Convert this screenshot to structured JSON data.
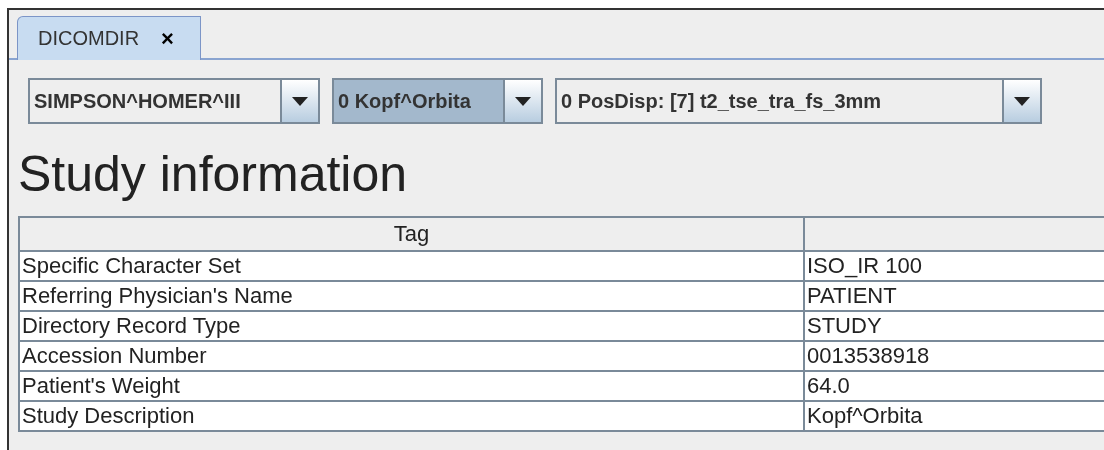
{
  "tabs": [
    {
      "label": "DICOMDIR",
      "close": "×",
      "selected": true
    }
  ],
  "combos": [
    {
      "value": "SIMPSON^HOMER^III",
      "focused": false
    },
    {
      "value": "0 Kopf^Orbita",
      "focused": true
    },
    {
      "value": "0 PosDisp: [7] t2_tse_tra_fs_3mm",
      "focused": false
    }
  ],
  "heading": "Study information",
  "table": {
    "columns": [
      "Tag"
    ],
    "rows": [
      {
        "tag": "Specific Character Set",
        "value": "ISO_IR 100"
      },
      {
        "tag": "Referring Physician's Name",
        "value": "PATIENT"
      },
      {
        "tag": "Directory Record Type",
        "value": "STUDY"
      },
      {
        "tag": "Accession Number",
        "value": "0013538918"
      },
      {
        "tag": "Patient's Weight",
        "value": "64.0"
      },
      {
        "tag": "Study Description",
        "value": "Kopf^Orbita"
      }
    ]
  }
}
